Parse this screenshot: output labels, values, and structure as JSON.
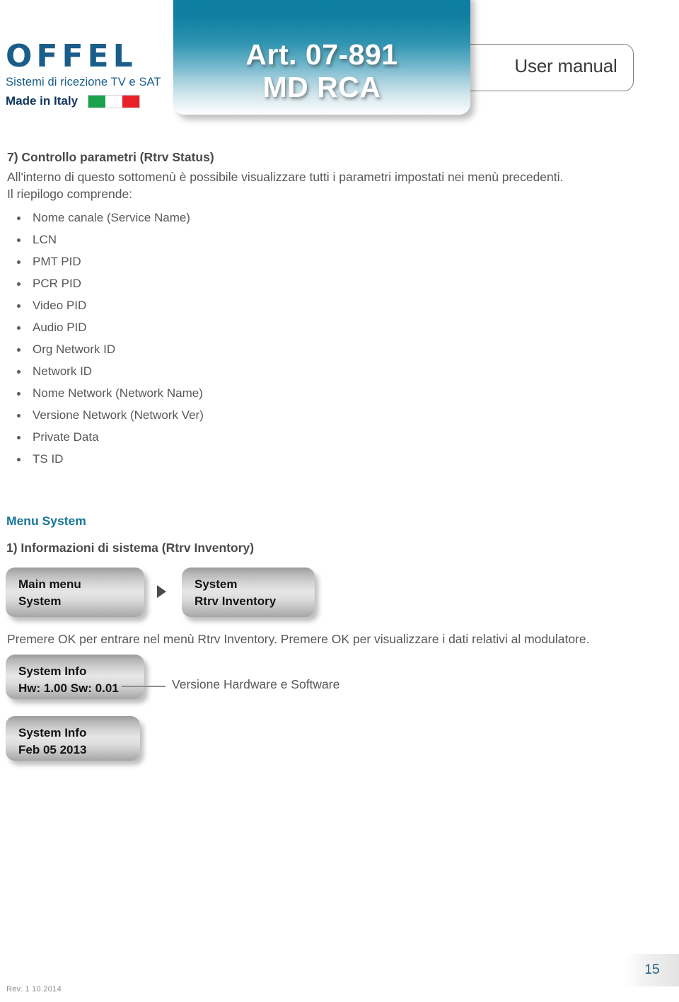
{
  "header": {
    "logo": {
      "brand": "OFFEL",
      "tagline": "Sistemi di ricezione TV e SAT",
      "made_in": "Made in Italy",
      "flag_colors": [
        "#1ba14e",
        "#ffffff",
        "#e8202a"
      ]
    },
    "article": {
      "line1": "Art. 07-891",
      "line2": "MD RCA",
      "gradient_top": "#0d7fa1",
      "gradient_bottom": "#ffffff"
    },
    "doc_type_label": "User manual"
  },
  "content": {
    "section_title": "7) Controllo parametri (Rtrv Status)",
    "paragraph_line1": "All'interno di questo sottomenù è possibile visualizzare tutti i parametri impostati nei menù precedenti.",
    "paragraph_line2": "Il riepilogo comprende:",
    "bullets": [
      "Nome canale (Service Name)",
      "LCN",
      "PMT PID",
      "PCR PID",
      "Video PID",
      "Audio PID",
      "Org Network ID",
      "Network ID",
      "Nome Network (Network Name)",
      "Versione Network (Network Ver)",
      "Private Data",
      "TS ID"
    ]
  },
  "menu_system": {
    "heading": "Menu System",
    "heading_color": "#17769a",
    "step_title": "1) Informazioni di sistema (Rtrv Inventory)",
    "lcd_main": {
      "line1": "Main menu",
      "line2": "System"
    },
    "lcd_system": {
      "line1": "System",
      "line2": "Rtrv Inventory"
    },
    "note": "Premere OK per entrare nel menù Rtrv Inventory. Premere OK per visualizzare i dati relativi al modulatore.",
    "lcd_hw": {
      "line1": "System Info",
      "line2": "Hw: 1.00  Sw: 0.01"
    },
    "connector_label": "Versione Hardware e Software",
    "lcd_date": {
      "line1": "System Info",
      "line2": "Feb  05  2013"
    }
  },
  "footer": {
    "revision": "Rev. 1    10.2014",
    "page_number": "15"
  }
}
